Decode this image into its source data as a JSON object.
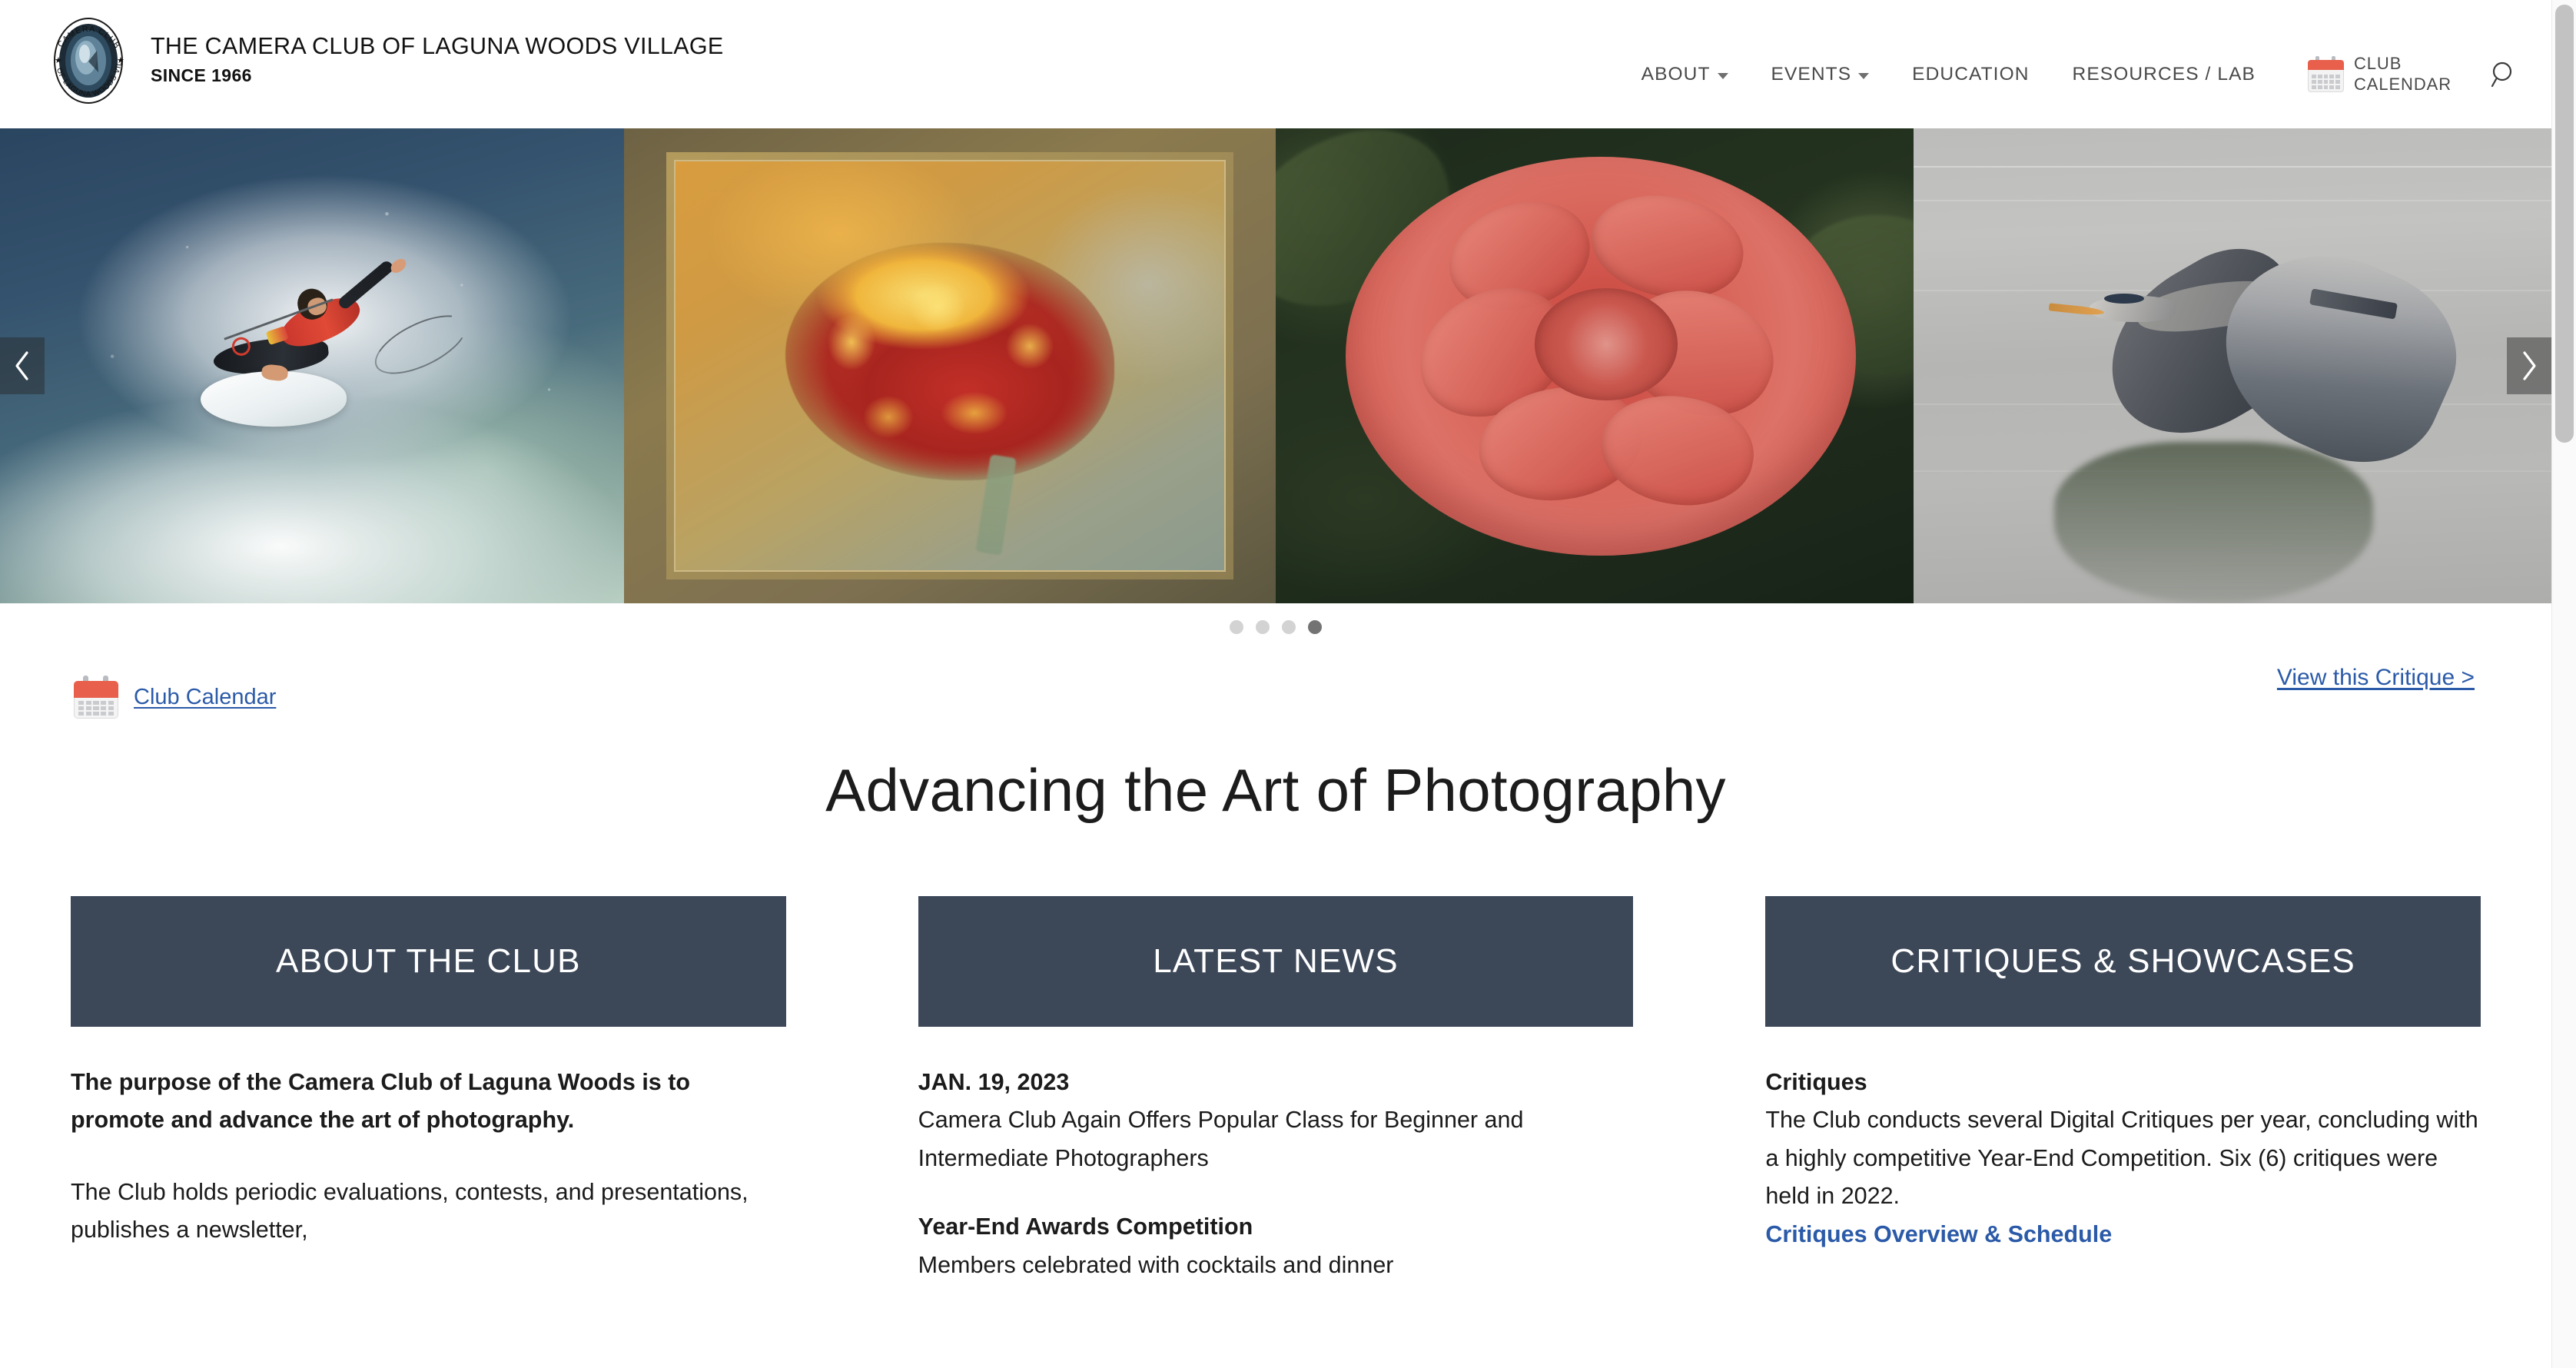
{
  "header": {
    "logo_alt": "Camera Club of Laguna Woods Village logo",
    "title_line1": "THE CAMERA CLUB OF LAGUNA WOODS VILLAGE",
    "title_line2": "SINCE 1966",
    "nav": [
      {
        "label": "ABOUT",
        "has_dropdown": true
      },
      {
        "label": "EVENTS",
        "has_dropdown": true
      },
      {
        "label": "EDUCATION",
        "has_dropdown": false
      },
      {
        "label": "RESOURCES / LAB",
        "has_dropdown": false
      }
    ],
    "calendar_label_line1": "CLUB",
    "calendar_label_line2": "CALENDAR",
    "search_label": "Search"
  },
  "carousel": {
    "slides": [
      {
        "caption": "Surfer carving a wave in ocean spray"
      },
      {
        "caption": "Framed painterly marigold flower on golden background"
      },
      {
        "caption": "Coral pink begonia bloom against dark green foliage"
      },
      {
        "caption": "Great blue heron in flight over still gray water with reflection"
      }
    ],
    "prev_label": "Previous slide",
    "next_label": "Next slide",
    "active_index": 3,
    "dot_count": 4
  },
  "link_row": {
    "calendar_link": "Club Calendar",
    "critique_link": "View this Critique >"
  },
  "hero": {
    "headline": "Advancing the Art of Photography"
  },
  "columns": [
    {
      "heading": "ABOUT THE CLUB",
      "lead": "The purpose of the Camera Club of Laguna Woods is to promote and advance the art of photography.",
      "paragraph": "The Club holds periodic evaluations, contests, and presentations, publishes a newsletter,"
    },
    {
      "heading": "LATEST NEWS",
      "date": "JAN. 19, 2023",
      "story": "Camera Club Again Offers Popular Class for Beginner and Intermediate Photographers",
      "subheading": "Year-End Awards Competition",
      "story2": "Members celebrated with cocktails and dinner"
    },
    {
      "heading": "CRITIQUES & SHOWCASES",
      "subheading": "Critiques",
      "paragraph": "The Club conducts several Digital Critiques per year, concluding with a highly competitive Year-End Competition. Six (6) critiques were held in 2022.",
      "link": "Critiques Overview & Schedule"
    }
  ],
  "colors": {
    "panel_header_bg": "#3c4758",
    "link_blue": "#2b5aa8",
    "calendar_accent": "#e8604c",
    "nav_text": "#4a4a4a",
    "dot_active": "#737373",
    "dot_inactive": "#d3d3d3"
  }
}
